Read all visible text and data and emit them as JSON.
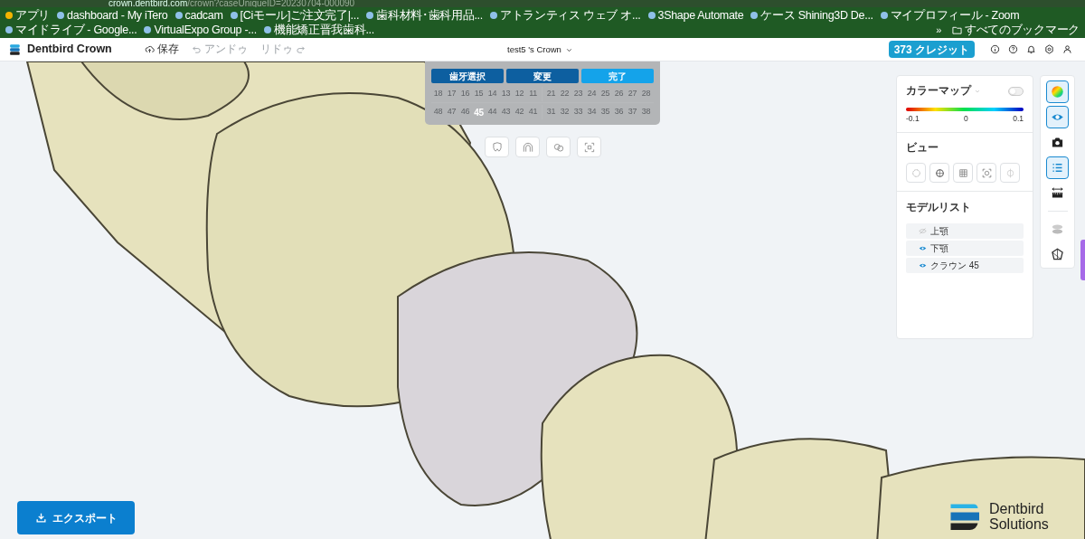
{
  "browser": {
    "url_host": "crown.dentbird.com",
    "url_path": "/crown?caseUniqueID=20230704-000090",
    "bookmarks": [
      {
        "label": "アプリ"
      },
      {
        "label": "dashboard - My iTero"
      },
      {
        "label": "cadcam"
      },
      {
        "label": "[Ciモール]ご注文完了|..."
      },
      {
        "label": "歯科材料･歯科用品..."
      },
      {
        "label": "アトランティス ウェブ オ..."
      },
      {
        "label": "3Shape Automate"
      },
      {
        "label": "ケース Shining3D De..."
      },
      {
        "label": "マイプロフィール - Zoom"
      },
      {
        "label": "マイドライブ - Google..."
      },
      {
        "label": "VirtualExpo Group -..."
      },
      {
        "label": "機能矯正晋我歯科..."
      }
    ],
    "more": "»",
    "all_bookmarks": "すべてのブックマーク"
  },
  "app": {
    "logo": "Dentbird Crown",
    "toolbar": [
      {
        "label": "保存",
        "kind": "save",
        "disabled": false
      },
      {
        "label": "アンドゥ",
        "kind": "undo",
        "disabled": true
      },
      {
        "label": "リドゥ",
        "kind": "redo",
        "disabled": true
      }
    ],
    "case_title": "test5 's Crown",
    "credits": "373 クレジット"
  },
  "tooth_selector": {
    "actions": [
      {
        "label": "歯牙選択",
        "selected": false
      },
      {
        "label": "変更",
        "selected": false
      },
      {
        "label": "完了",
        "selected": true
      }
    ],
    "upper": [
      {
        "number": "18",
        "selected": false
      },
      {
        "number": "17",
        "selected": false
      },
      {
        "number": "16",
        "selected": false
      },
      {
        "number": "15",
        "selected": false
      },
      {
        "number": "14",
        "selected": false
      },
      {
        "number": "13",
        "selected": false
      },
      {
        "number": "12",
        "selected": false
      },
      {
        "number": "11",
        "selected": false
      },
      {
        "number": "21",
        "selected": false
      },
      {
        "number": "22",
        "selected": false
      },
      {
        "number": "23",
        "selected": false
      },
      {
        "number": "24",
        "selected": false
      },
      {
        "number": "25",
        "selected": false
      },
      {
        "number": "26",
        "selected": false
      },
      {
        "number": "27",
        "selected": false
      },
      {
        "number": "28",
        "selected": false
      }
    ],
    "lower": [
      {
        "number": "48",
        "selected": false
      },
      {
        "number": "47",
        "selected": false
      },
      {
        "number": "46",
        "selected": false
      },
      {
        "number": "45",
        "selected": true
      },
      {
        "number": "44",
        "selected": false
      },
      {
        "number": "43",
        "selected": false
      },
      {
        "number": "42",
        "selected": false
      },
      {
        "number": "41",
        "selected": false
      },
      {
        "number": "31",
        "selected": false
      },
      {
        "number": "32",
        "selected": false
      },
      {
        "number": "33",
        "selected": false
      },
      {
        "number": "34",
        "selected": false
      },
      {
        "number": "35",
        "selected": false
      },
      {
        "number": "36",
        "selected": false
      },
      {
        "number": "37",
        "selected": false
      },
      {
        "number": "38",
        "selected": false
      }
    ]
  },
  "panel": {
    "color_map": {
      "title": "カラーマップ",
      "enabled": false,
      "scale": [
        "-0.1",
        "0",
        "0.1"
      ]
    },
    "view": {
      "title": "ビュー"
    },
    "model_list": {
      "title": "モデルリスト",
      "items": [
        {
          "label": "上顎",
          "visible": false
        },
        {
          "label": "下顎",
          "visible": true
        },
        {
          "label": "クラウン 45",
          "visible": true
        }
      ]
    }
  },
  "side_toolbar": [
    {
      "kind": "colormap",
      "active": true
    },
    {
      "kind": "eye",
      "active": true
    },
    {
      "kind": "camera",
      "active": false
    },
    {
      "kind": "list",
      "active": true
    },
    {
      "kind": "ruler",
      "active": false
    },
    {
      "kind": "jaw",
      "active": false
    },
    {
      "kind": "tool",
      "active": false
    }
  ],
  "export": {
    "label": "エクスポート"
  },
  "brand": {
    "line_1": "Dentbird",
    "line_2": "Solutions"
  }
}
